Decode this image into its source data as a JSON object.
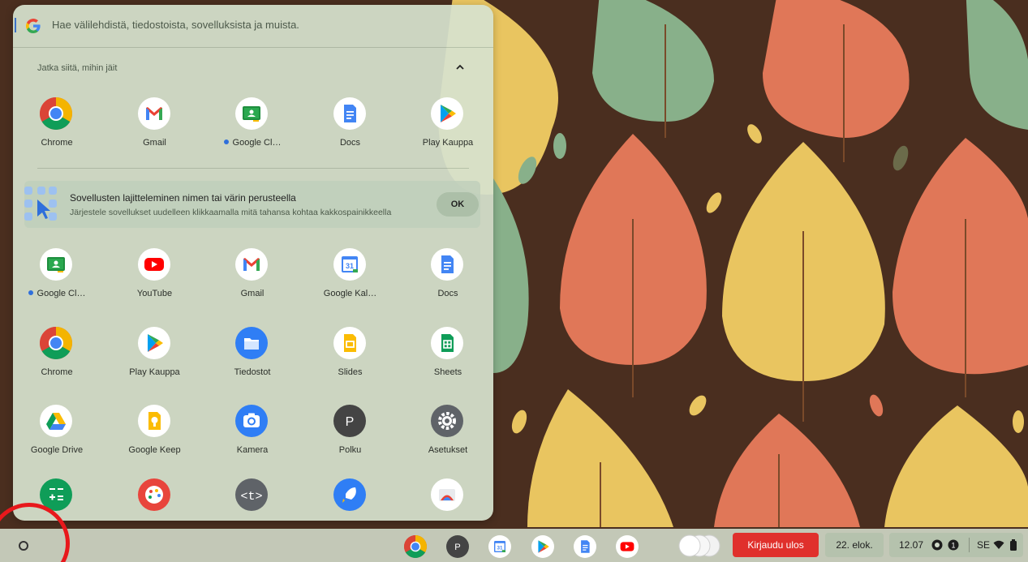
{
  "search": {
    "placeholder": "Hae välilehdistä, tiedostoista, sovelluksista ja muista.",
    "icon": "google-g-icon"
  },
  "continue_section": {
    "title": "Jatka siitä, mihin jäit",
    "apps": [
      {
        "label": "Chrome",
        "icon": "chrome-icon",
        "new": false
      },
      {
        "label": "Gmail",
        "icon": "gmail-icon",
        "new": false
      },
      {
        "label": "Google Cl…",
        "icon": "google-classroom-icon",
        "new": true
      },
      {
        "label": "Docs",
        "icon": "docs-icon",
        "new": false
      },
      {
        "label": "Play Kauppa",
        "icon": "play-store-icon",
        "new": false
      }
    ]
  },
  "sort_nudge": {
    "title": "Sovellusten lajitteleminen nimen tai värin perusteella",
    "subtitle": "Järjestele sovellukset uudelleen klikkaamalla mitä tahansa kohtaa kakkospainikkeella",
    "ok_label": "OK"
  },
  "app_grid": [
    [
      {
        "label": "Google Cl…",
        "icon": "google-classroom-icon",
        "new": true
      },
      {
        "label": "YouTube",
        "icon": "youtube-icon",
        "new": false
      },
      {
        "label": "Gmail",
        "icon": "gmail-icon",
        "new": false
      },
      {
        "label": "Google Kal…",
        "icon": "google-calendar-icon",
        "new": false
      },
      {
        "label": "Docs",
        "icon": "docs-icon",
        "new": false
      }
    ],
    [
      {
        "label": "Chrome",
        "icon": "chrome-icon",
        "new": false
      },
      {
        "label": "Play Kauppa",
        "icon": "play-store-icon",
        "new": false
      },
      {
        "label": "Tiedostot",
        "icon": "files-icon",
        "new": false
      },
      {
        "label": "Slides",
        "icon": "slides-icon",
        "new": false
      },
      {
        "label": "Sheets",
        "icon": "sheets-icon",
        "new": false
      }
    ],
    [
      {
        "label": "Google Drive",
        "icon": "google-drive-icon",
        "new": false
      },
      {
        "label": "Google Keep",
        "icon": "google-keep-icon",
        "new": false
      },
      {
        "label": "Kamera",
        "icon": "camera-icon",
        "new": false
      },
      {
        "label": "Polku",
        "icon": "polku-icon",
        "new": false
      },
      {
        "label": "Asetukset",
        "icon": "settings-icon",
        "new": false
      }
    ],
    [
      {
        "label": "",
        "icon": "calculator-icon",
        "new": false
      },
      {
        "label": "",
        "icon": "canvas-icon",
        "new": false
      },
      {
        "label": "",
        "icon": "text-editor-icon",
        "new": false
      },
      {
        "label": "",
        "icon": "explore-icon",
        "new": false
      },
      {
        "label": "",
        "icon": "screen-capture-icon",
        "new": false
      }
    ]
  ],
  "polku_letter": "P",
  "shelf": {
    "launcher_icon": "launcher-circle-icon",
    "pinned_apps": [
      "chrome-icon",
      "polku-icon",
      "google-calendar-icon",
      "play-store-icon",
      "docs-icon",
      "youtube-icon"
    ],
    "sign_out_label": "Kirjaudu ulos",
    "date": "22. elok.",
    "time": "12.07",
    "keyboard_layout": "SE",
    "status_icons": [
      "record-icon",
      "notification-count-icon",
      "wifi-icon",
      "battery-icon"
    ],
    "notification_count": "1"
  },
  "colors": {
    "accent_blue": "#2f6fdb",
    "sign_out_red": "#e0302c",
    "highlight_circle": "#e8181c"
  }
}
